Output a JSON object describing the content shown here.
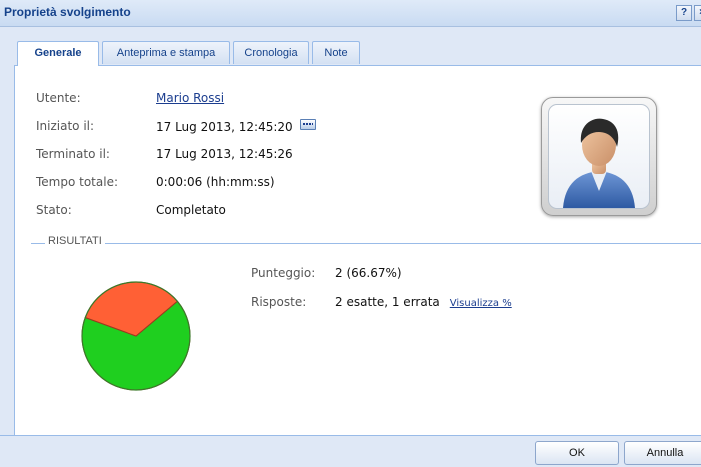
{
  "window": {
    "title": "Proprietà svolgimento",
    "help_label": "?",
    "close_label": "×"
  },
  "tabs": [
    {
      "label": "Generale",
      "active": true
    },
    {
      "label": "Anteprima e stampa",
      "active": false
    },
    {
      "label": "Cronologia",
      "active": false
    },
    {
      "label": "Note",
      "active": false
    }
  ],
  "fields": {
    "user": {
      "label": "Utente:",
      "value": "Mario Rossi"
    },
    "started": {
      "label": "Iniziato il:",
      "value": "17 Lug 2013, 12:45:20"
    },
    "ended": {
      "label": "Terminato il:",
      "value": "17 Lug 2013, 12:45:26"
    },
    "total": {
      "label": "Tempo totale:",
      "value": "0:00:06 (hh:mm:ss)"
    },
    "status": {
      "label": "Stato:",
      "value": "Completato"
    }
  },
  "results": {
    "section_title": "RISULTATI",
    "score": {
      "label": "Punteggio:",
      "value": "2 (66.67%)"
    },
    "answers": {
      "label": "Risposte:",
      "value": "2 esatte, 1 errata",
      "link": "Visualizza %"
    }
  },
  "chart_data": {
    "type": "pie",
    "categories": [
      "esatte",
      "errata"
    ],
    "values": [
      2,
      1
    ],
    "colors": [
      "#1fcf1f",
      "#ff6035"
    ]
  },
  "buttons": {
    "ok": "OK",
    "cancel": "Annulla"
  },
  "icons": {
    "calendar": "calendar-icon",
    "avatar": "user-avatar-icon"
  }
}
